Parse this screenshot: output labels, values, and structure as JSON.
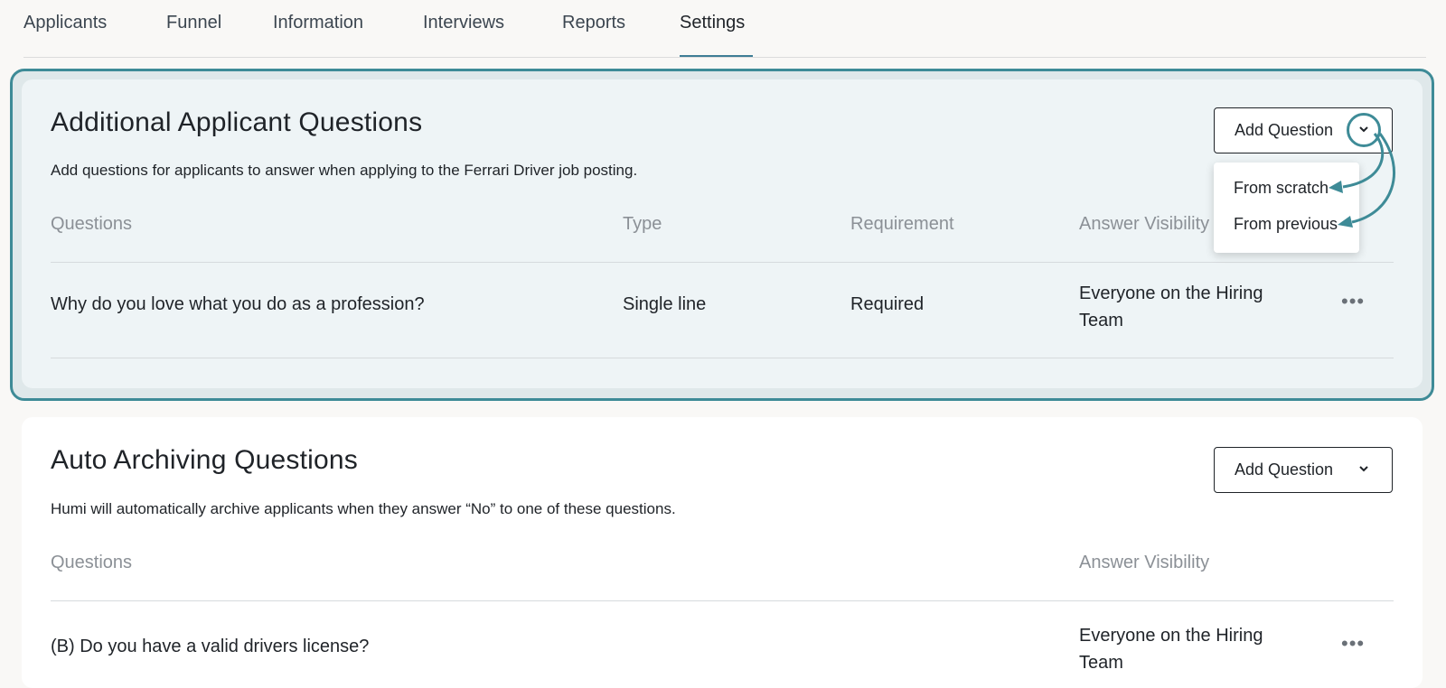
{
  "tabs": [
    {
      "label": "Applicants",
      "active": false
    },
    {
      "label": "Funnel",
      "active": false
    },
    {
      "label": "Information",
      "active": false
    },
    {
      "label": "Interviews",
      "active": false
    },
    {
      "label": "Reports",
      "active": false
    },
    {
      "label": "Settings",
      "active": true
    }
  ],
  "additional": {
    "title": "Additional Applicant Questions",
    "description": "Add questions for applicants to answer when applying to the Ferrari Driver job posting.",
    "add_button": "Add Question",
    "columns": [
      "Questions",
      "Type",
      "Requirement",
      "Answer Visibility"
    ],
    "rows": [
      {
        "question": "Why do you love what you do as a profession?",
        "type": "Single line",
        "requirement": "Required",
        "visibility": "Everyone on the Hiring Team",
        "more": "•••"
      }
    ],
    "dropdown": {
      "items": [
        "From scratch",
        "From previous"
      ]
    }
  },
  "archiving": {
    "title": "Auto Archiving Questions",
    "description": "Humi will automatically archive applicants when they answer “No” to one of these questions.",
    "add_button": "Add Question",
    "columns": [
      "Questions",
      "Answer Visibility"
    ],
    "rows": [
      {
        "question": "(B) Do you have a valid drivers license?",
        "visibility": "Everyone on the Hiring Team",
        "more": "•••"
      }
    ]
  },
  "colors": {
    "accent": "#3e8b97",
    "tab_underline": "#3f7d95",
    "highlight_bg": "#eef4f6"
  }
}
